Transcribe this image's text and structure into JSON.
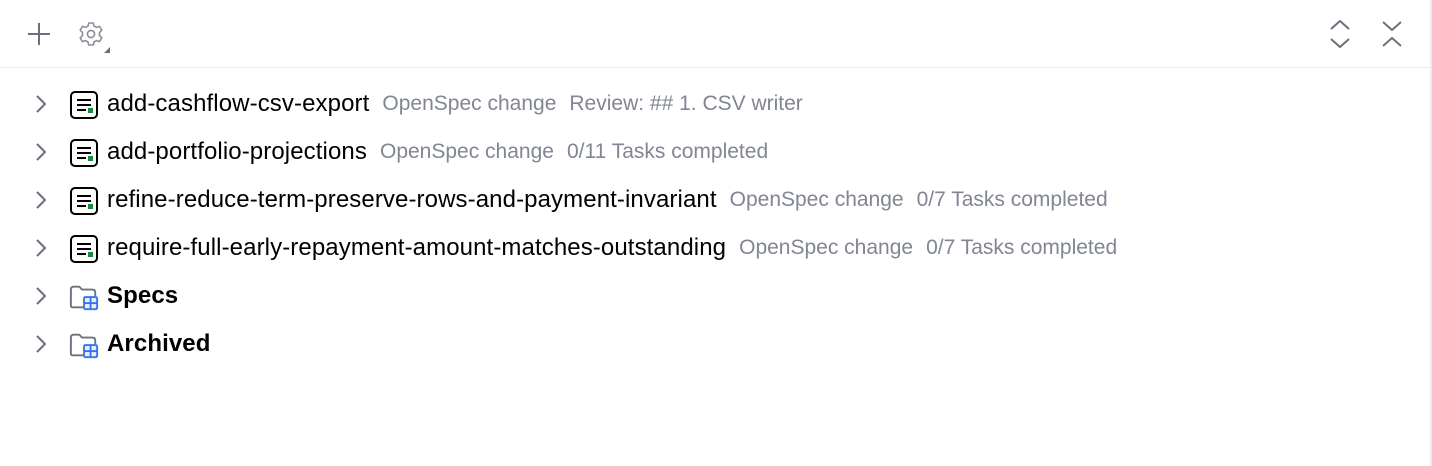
{
  "toolbar": {
    "add_icon": "plus-icon",
    "settings_icon": "gear-icon",
    "expand_icon": "expand-all-icon",
    "collapse_icon": "collapse-all-icon"
  },
  "tree": {
    "items": [
      {
        "name": "add-cashflow-csv-export",
        "type": "OpenSpec change",
        "status": "Review: ## 1. CSV writer",
        "icon": "change-doc-icon"
      },
      {
        "name": "add-portfolio-projections",
        "type": "OpenSpec change",
        "status": "0/11 Tasks completed",
        "icon": "change-doc-icon"
      },
      {
        "name": "refine-reduce-term-preserve-rows-and-payment-invariant",
        "type": "OpenSpec change",
        "status": "0/7 Tasks completed",
        "icon": "change-doc-icon"
      },
      {
        "name": "require-full-early-repayment-amount-matches-outstanding",
        "type": "OpenSpec change",
        "status": "0/7 Tasks completed",
        "icon": "change-doc-icon"
      },
      {
        "name": "Specs",
        "icon": "module-folder-icon"
      },
      {
        "name": "Archived",
        "icon": "module-folder-icon"
      }
    ]
  },
  "colors": {
    "text": "#000000",
    "meta_text": "#818594",
    "icon_gray": "#6c707e",
    "accent_green": "#208a3c",
    "accent_blue": "#3574f0",
    "border": "#ebecf0"
  }
}
